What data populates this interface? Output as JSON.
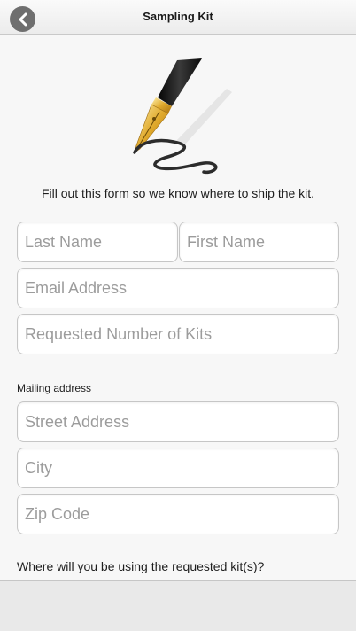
{
  "header": {
    "title": "Sampling Kit",
    "back_icon": "chevron-left-icon"
  },
  "illustration": {
    "icon": "fountain-pen-signature-icon"
  },
  "intro_text": "Fill out this form so we know where to ship the kit.",
  "form": {
    "last_name": {
      "placeholder": "Last Name",
      "value": ""
    },
    "first_name": {
      "placeholder": "First Name",
      "value": ""
    },
    "email": {
      "placeholder": "Email Address",
      "value": ""
    },
    "kits": {
      "placeholder": "Requested Number of Kits",
      "value": ""
    },
    "mailing_label": "Mailing address",
    "street": {
      "placeholder": "Street Address",
      "value": ""
    },
    "city": {
      "placeholder": "City",
      "value": ""
    },
    "zip": {
      "placeholder": "Zip Code",
      "value": ""
    },
    "usage_question": "Where will you be using the requested kit(s)?"
  },
  "colors": {
    "header_bg": "#f2f2f2",
    "back_button": "#6f6f6f",
    "field_border": "#c6c6c6",
    "placeholder": "#9c9c9c"
  }
}
